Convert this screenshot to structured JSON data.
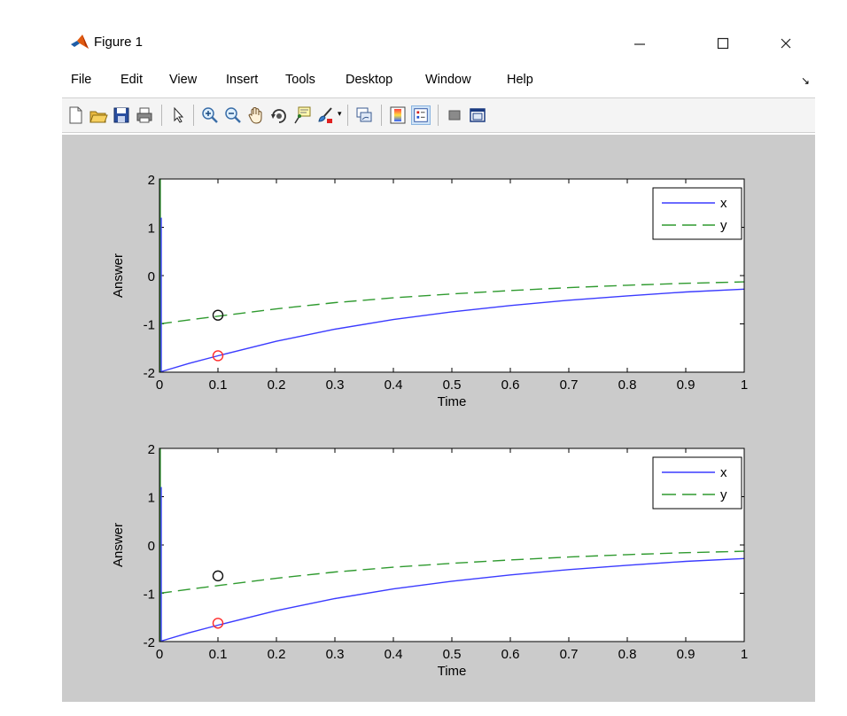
{
  "window": {
    "title": "Figure 1"
  },
  "icons": {
    "app": "matlab-icon",
    "minimize": "minimize-icon",
    "maximize": "maximize-icon",
    "close": "close-icon"
  },
  "menu": {
    "items": [
      "File",
      "Edit",
      "View",
      "Insert",
      "Tools",
      "Desktop",
      "Window",
      "Help"
    ]
  },
  "toolbar": {
    "buttons": [
      "new-figure-icon",
      "open-file-icon",
      "save-icon",
      "print-icon",
      "edit-plot-arrow-icon",
      "zoom-in-icon",
      "zoom-out-icon",
      "pan-hand-icon",
      "rotate-3d-icon",
      "data-cursor-icon",
      "brush-icon",
      "link-plot-icon",
      "colorbar-icon",
      "legend-icon",
      "hide-plot-tools-icon",
      "show-plot-tools-icon"
    ]
  },
  "colors": {
    "series_x": "#3b3bff",
    "series_y": "#2f9a2f",
    "marker_red": "#ff2a2a",
    "marker_black": "#111111"
  },
  "chart_data": [
    {
      "type": "line",
      "title": "",
      "xlabel": "Time",
      "ylabel": "Answer",
      "xlim": [
        0,
        1
      ],
      "ylim": [
        -2,
        2
      ],
      "xticks": [
        "0",
        "0.1",
        "0.2",
        "0.3",
        "0.4",
        "0.5",
        "0.6",
        "0.7",
        "0.8",
        "0.9",
        "1"
      ],
      "yticks": [
        "-2",
        "-1",
        "0",
        "1",
        "2"
      ],
      "legend": {
        "placement": "top-right",
        "entries": [
          "x",
          "y"
        ]
      },
      "series": [
        {
          "name": "x",
          "style": "solid",
          "x": [
            0,
            0.05,
            0.1,
            0.2,
            0.3,
            0.4,
            0.5,
            0.6,
            0.7,
            0.8,
            0.9,
            1
          ],
          "y": [
            -2.0,
            -1.82,
            -1.66,
            -1.36,
            -1.11,
            -0.91,
            -0.75,
            -0.62,
            -0.51,
            -0.42,
            -0.34,
            -0.28
          ]
        },
        {
          "name": "y",
          "style": "dashed",
          "x": [
            0,
            0.05,
            0.1,
            0.2,
            0.3,
            0.4,
            0.5,
            0.6,
            0.7,
            0.8,
            0.9,
            1
          ],
          "y": [
            -1.0,
            -0.92,
            -0.84,
            -0.69,
            -0.56,
            -0.46,
            -0.38,
            -0.31,
            -0.25,
            -0.2,
            -0.16,
            -0.13
          ]
        }
      ],
      "markers": [
        {
          "x": 0.1,
          "y": -1.66,
          "color": "red"
        },
        {
          "x": 0.1,
          "y": -0.82,
          "color": "black"
        }
      ]
    },
    {
      "type": "line",
      "title": "",
      "xlabel": "Time",
      "ylabel": "Answer",
      "xlim": [
        0,
        1
      ],
      "ylim": [
        -2,
        2
      ],
      "xticks": [
        "0",
        "0.1",
        "0.2",
        "0.3",
        "0.4",
        "0.5",
        "0.6",
        "0.7",
        "0.8",
        "0.9",
        "1"
      ],
      "yticks": [
        "-2",
        "-1",
        "0",
        "1",
        "2"
      ],
      "legend": {
        "placement": "top-right",
        "entries": [
          "x",
          "y"
        ]
      },
      "series": [
        {
          "name": "x",
          "style": "solid",
          "x": [
            0,
            0.05,
            0.1,
            0.2,
            0.3,
            0.4,
            0.5,
            0.6,
            0.7,
            0.8,
            0.9,
            1
          ],
          "y": [
            -2.0,
            -1.82,
            -1.66,
            -1.36,
            -1.11,
            -0.91,
            -0.75,
            -0.62,
            -0.51,
            -0.42,
            -0.34,
            -0.28
          ]
        },
        {
          "name": "y",
          "style": "dashed",
          "x": [
            0,
            0.05,
            0.1,
            0.2,
            0.3,
            0.4,
            0.5,
            0.6,
            0.7,
            0.8,
            0.9,
            1
          ],
          "y": [
            -1.0,
            -0.92,
            -0.84,
            -0.69,
            -0.56,
            -0.46,
            -0.38,
            -0.31,
            -0.25,
            -0.2,
            -0.16,
            -0.13
          ]
        }
      ],
      "markers": [
        {
          "x": 0.1,
          "y": -1.62,
          "color": "red"
        },
        {
          "x": 0.1,
          "y": -0.64,
          "color": "black"
        }
      ]
    }
  ]
}
